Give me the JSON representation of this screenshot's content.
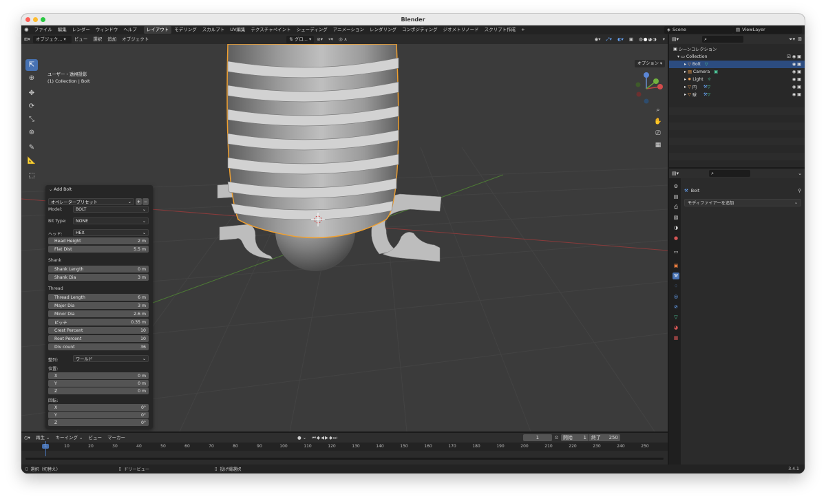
{
  "window": {
    "title": "Blender",
    "version": "3.4.1"
  },
  "menu": [
    "ファイル",
    "編集",
    "レンダー",
    "ウィンドウ",
    "ヘルプ"
  ],
  "workspaces": [
    "レイアウト",
    "モデリング",
    "スカルプト",
    "UV編集",
    "テクスチャペイント",
    "シェーディング",
    "アニメーション",
    "レンダリング",
    "コンポジティング",
    "ジオメトリノード",
    "スクリプト作成"
  ],
  "active_workspace": "レイアウト",
  "scene": {
    "name": "Scene",
    "view_layer": "ViewLayer"
  },
  "viewport_header": {
    "mode": "オブジェク...",
    "menus": [
      "ビュー",
      "選択",
      "追加",
      "オブジェクト"
    ],
    "transform": "グロ...",
    "options": "オプション"
  },
  "viewport": {
    "view_name": "ユーザー・透視投影",
    "collection_info": "(1) Collection | Bolt"
  },
  "operator_panel": {
    "title": "Add Bolt",
    "preset": "オペレータープリセット",
    "model_label": "Model:",
    "model_value": "BOLT",
    "bit_type_label": "Bit Type:",
    "bit_type_value": "NONE",
    "head_label": "ヘッド:",
    "head_value": "HEX",
    "head_height_label": "Head Height",
    "head_height_value": "2 m",
    "flat_dist_label": "Flat Dist",
    "flat_dist_value": "5.5 m",
    "shank_section": "Shank",
    "shank_length_label": "Shank Length",
    "shank_length_value": "0 m",
    "shank_dia_label": "Shank Dia",
    "shank_dia_value": "3 m",
    "thread_section": "Thread",
    "thread_length_label": "Thread Length",
    "thread_length_value": "6 m",
    "major_dia_label": "Major Dia",
    "major_dia_value": "3 m",
    "minor_dia_label": "Minor Dia",
    "minor_dia_value": "2.6 m",
    "pitch_label": "ピッチ",
    "pitch_value": "0.35 m",
    "crest_percent_label": "Crest Percent",
    "crest_percent_value": "10",
    "root_percent_label": "Root Percent",
    "root_percent_value": "10",
    "div_count_label": "Div count",
    "div_count_value": "36",
    "align_label": "整列:",
    "align_value": "ワールド",
    "location_label": "位置:",
    "loc_x_label": "X",
    "loc_x_value": "0 m",
    "loc_y_label": "Y",
    "loc_y_value": "0 m",
    "loc_z_label": "Z",
    "loc_z_value": "0 m",
    "rotation_label": "回転:",
    "rot_x_label": "X",
    "rot_x_value": "0°",
    "rot_y_label": "Y",
    "rot_y_value": "0°",
    "rot_z_label": "Z",
    "rot_z_value": "0°"
  },
  "outliner": {
    "scene_collection": "シーンコレクション",
    "collection": "Collection",
    "items": [
      "Bolt",
      "Camera",
      "Light",
      "円",
      "球"
    ]
  },
  "properties": {
    "object_name": "Bolt",
    "add_modifier": "モディファイアーを追加"
  },
  "timeline": {
    "menus": [
      "再生",
      "キーイング",
      "ビュー",
      "マーカー"
    ],
    "current_frame": "1",
    "start_label": "開始",
    "start": "1",
    "end_label": "終了",
    "end": "250",
    "ticks": [
      "1",
      "10",
      "20",
      "30",
      "40",
      "50",
      "60",
      "70",
      "80",
      "90",
      "100",
      "110",
      "120",
      "130",
      "140",
      "150",
      "160",
      "170",
      "180",
      "190",
      "200",
      "210",
      "220",
      "230",
      "240",
      "250"
    ]
  },
  "status": {
    "select": "選択（切替え）",
    "dolly": "ドリービュー",
    "context": "投げ縄選択"
  }
}
